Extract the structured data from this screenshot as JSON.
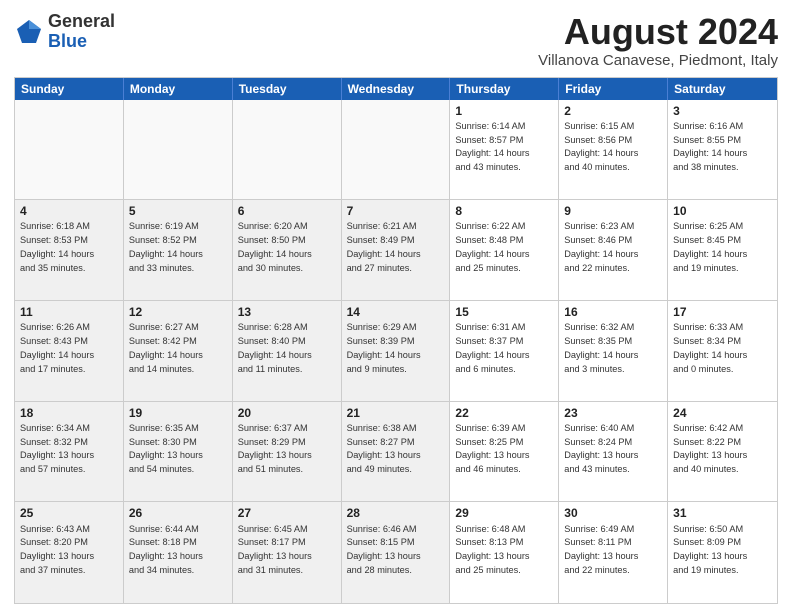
{
  "logo": {
    "general": "General",
    "blue": "Blue"
  },
  "title": "August 2024",
  "subtitle": "Villanova Canavese, Piedmont, Italy",
  "header_days": [
    "Sunday",
    "Monday",
    "Tuesday",
    "Wednesday",
    "Thursday",
    "Friday",
    "Saturday"
  ],
  "weeks": [
    [
      {
        "day": "",
        "info": "",
        "shaded": true
      },
      {
        "day": "",
        "info": "",
        "shaded": true
      },
      {
        "day": "",
        "info": "",
        "shaded": true
      },
      {
        "day": "",
        "info": "",
        "shaded": true
      },
      {
        "day": "1",
        "info": "Sunrise: 6:14 AM\nSunset: 8:57 PM\nDaylight: 14 hours\nand 43 minutes.",
        "shaded": false
      },
      {
        "day": "2",
        "info": "Sunrise: 6:15 AM\nSunset: 8:56 PM\nDaylight: 14 hours\nand 40 minutes.",
        "shaded": false
      },
      {
        "day": "3",
        "info": "Sunrise: 6:16 AM\nSunset: 8:55 PM\nDaylight: 14 hours\nand 38 minutes.",
        "shaded": false
      }
    ],
    [
      {
        "day": "4",
        "info": "Sunrise: 6:18 AM\nSunset: 8:53 PM\nDaylight: 14 hours\nand 35 minutes.",
        "shaded": true
      },
      {
        "day": "5",
        "info": "Sunrise: 6:19 AM\nSunset: 8:52 PM\nDaylight: 14 hours\nand 33 minutes.",
        "shaded": true
      },
      {
        "day": "6",
        "info": "Sunrise: 6:20 AM\nSunset: 8:50 PM\nDaylight: 14 hours\nand 30 minutes.",
        "shaded": true
      },
      {
        "day": "7",
        "info": "Sunrise: 6:21 AM\nSunset: 8:49 PM\nDaylight: 14 hours\nand 27 minutes.",
        "shaded": true
      },
      {
        "day": "8",
        "info": "Sunrise: 6:22 AM\nSunset: 8:48 PM\nDaylight: 14 hours\nand 25 minutes.",
        "shaded": false
      },
      {
        "day": "9",
        "info": "Sunrise: 6:23 AM\nSunset: 8:46 PM\nDaylight: 14 hours\nand 22 minutes.",
        "shaded": false
      },
      {
        "day": "10",
        "info": "Sunrise: 6:25 AM\nSunset: 8:45 PM\nDaylight: 14 hours\nand 19 minutes.",
        "shaded": false
      }
    ],
    [
      {
        "day": "11",
        "info": "Sunrise: 6:26 AM\nSunset: 8:43 PM\nDaylight: 14 hours\nand 17 minutes.",
        "shaded": true
      },
      {
        "day": "12",
        "info": "Sunrise: 6:27 AM\nSunset: 8:42 PM\nDaylight: 14 hours\nand 14 minutes.",
        "shaded": true
      },
      {
        "day": "13",
        "info": "Sunrise: 6:28 AM\nSunset: 8:40 PM\nDaylight: 14 hours\nand 11 minutes.",
        "shaded": true
      },
      {
        "day": "14",
        "info": "Sunrise: 6:29 AM\nSunset: 8:39 PM\nDaylight: 14 hours\nand 9 minutes.",
        "shaded": true
      },
      {
        "day": "15",
        "info": "Sunrise: 6:31 AM\nSunset: 8:37 PM\nDaylight: 14 hours\nand 6 minutes.",
        "shaded": false
      },
      {
        "day": "16",
        "info": "Sunrise: 6:32 AM\nSunset: 8:35 PM\nDaylight: 14 hours\nand 3 minutes.",
        "shaded": false
      },
      {
        "day": "17",
        "info": "Sunrise: 6:33 AM\nSunset: 8:34 PM\nDaylight: 14 hours\nand 0 minutes.",
        "shaded": false
      }
    ],
    [
      {
        "day": "18",
        "info": "Sunrise: 6:34 AM\nSunset: 8:32 PM\nDaylight: 13 hours\nand 57 minutes.",
        "shaded": true
      },
      {
        "day": "19",
        "info": "Sunrise: 6:35 AM\nSunset: 8:30 PM\nDaylight: 13 hours\nand 54 minutes.",
        "shaded": true
      },
      {
        "day": "20",
        "info": "Sunrise: 6:37 AM\nSunset: 8:29 PM\nDaylight: 13 hours\nand 51 minutes.",
        "shaded": true
      },
      {
        "day": "21",
        "info": "Sunrise: 6:38 AM\nSunset: 8:27 PM\nDaylight: 13 hours\nand 49 minutes.",
        "shaded": true
      },
      {
        "day": "22",
        "info": "Sunrise: 6:39 AM\nSunset: 8:25 PM\nDaylight: 13 hours\nand 46 minutes.",
        "shaded": false
      },
      {
        "day": "23",
        "info": "Sunrise: 6:40 AM\nSunset: 8:24 PM\nDaylight: 13 hours\nand 43 minutes.",
        "shaded": false
      },
      {
        "day": "24",
        "info": "Sunrise: 6:42 AM\nSunset: 8:22 PM\nDaylight: 13 hours\nand 40 minutes.",
        "shaded": false
      }
    ],
    [
      {
        "day": "25",
        "info": "Sunrise: 6:43 AM\nSunset: 8:20 PM\nDaylight: 13 hours\nand 37 minutes.",
        "shaded": true
      },
      {
        "day": "26",
        "info": "Sunrise: 6:44 AM\nSunset: 8:18 PM\nDaylight: 13 hours\nand 34 minutes.",
        "shaded": true
      },
      {
        "day": "27",
        "info": "Sunrise: 6:45 AM\nSunset: 8:17 PM\nDaylight: 13 hours\nand 31 minutes.",
        "shaded": true
      },
      {
        "day": "28",
        "info": "Sunrise: 6:46 AM\nSunset: 8:15 PM\nDaylight: 13 hours\nand 28 minutes.",
        "shaded": true
      },
      {
        "day": "29",
        "info": "Sunrise: 6:48 AM\nSunset: 8:13 PM\nDaylight: 13 hours\nand 25 minutes.",
        "shaded": false
      },
      {
        "day": "30",
        "info": "Sunrise: 6:49 AM\nSunset: 8:11 PM\nDaylight: 13 hours\nand 22 minutes.",
        "shaded": false
      },
      {
        "day": "31",
        "info": "Sunrise: 6:50 AM\nSunset: 8:09 PM\nDaylight: 13 hours\nand 19 minutes.",
        "shaded": false
      }
    ]
  ]
}
